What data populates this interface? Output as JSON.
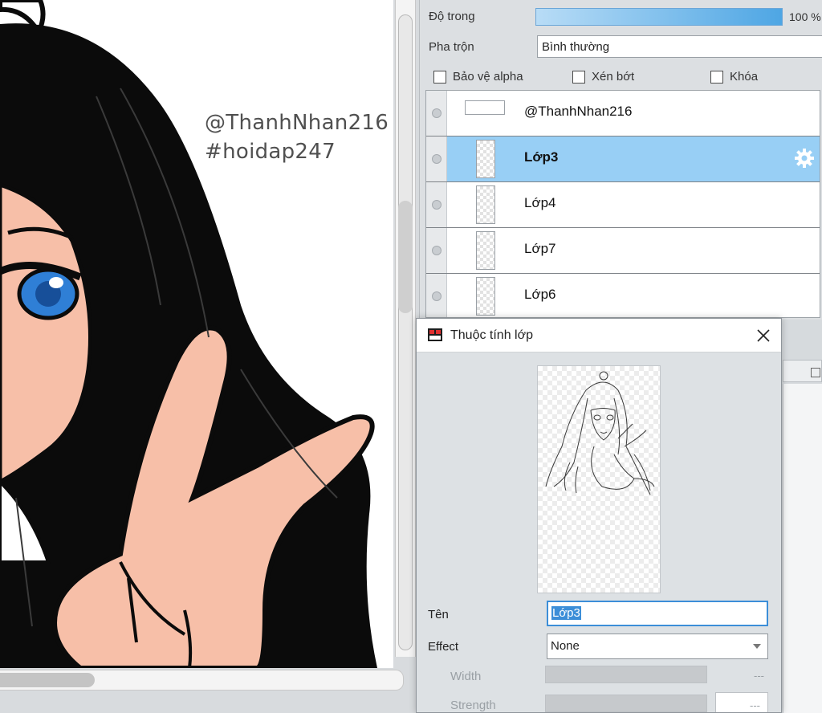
{
  "canvas": {
    "watermark_line1": "@ThanhNhan216",
    "watermark_line2": "#hoidap247"
  },
  "layer_panel": {
    "opacity_label": "Độ trong",
    "opacity_value": "100 %",
    "blend_label": "Pha trộn",
    "blend_value": "Bình thường",
    "checkboxes": [
      "Bảo vệ alpha",
      "Xén bớt",
      "Khóa"
    ],
    "layers": [
      {
        "name": "@ThanhNhan216",
        "selected": false
      },
      {
        "name": "Lớp3",
        "selected": true
      },
      {
        "name": "Lớp4",
        "selected": false
      },
      {
        "name": "Lớp7",
        "selected": false
      },
      {
        "name": "Lớp6",
        "selected": false
      }
    ]
  },
  "dialog": {
    "title": "Thuộc tính lớp",
    "name_label": "Tên",
    "name_value": "Lớp3",
    "effect_label": "Effect",
    "effect_value": "None",
    "width_label": "Width",
    "width_value": "---",
    "strength_label": "Strength",
    "strength_value": "---"
  },
  "colors": {
    "selection": "#98cff5",
    "opacity_fill": "#4ea6e4",
    "skin": "#f7bfa8",
    "hair": "#0b0b0b",
    "eye": "#2f7fd6"
  }
}
